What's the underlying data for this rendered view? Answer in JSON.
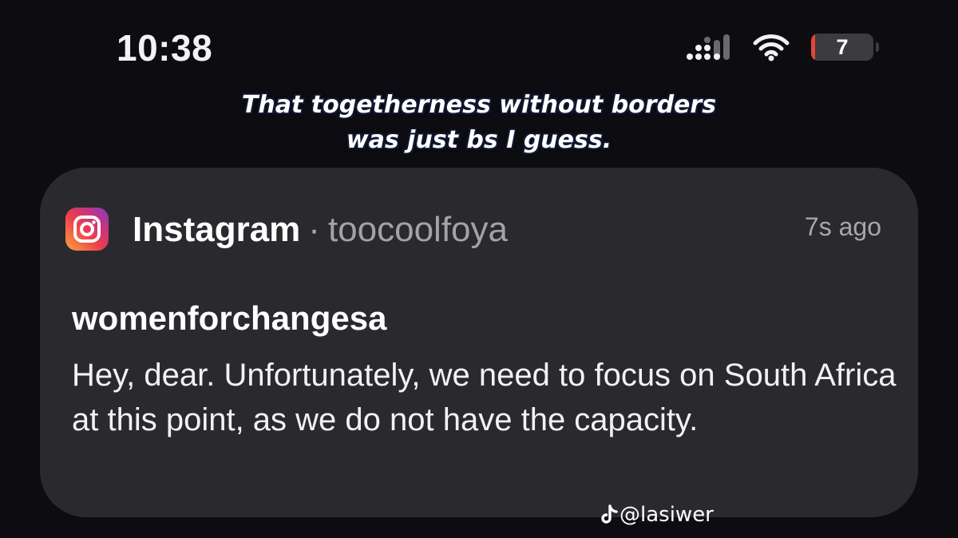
{
  "status_bar": {
    "time": "10:38",
    "battery_level": "7",
    "battery_fraction": 0.07,
    "signal_icon": "cellular-signal-icon",
    "wifi_icon": "wifi-icon",
    "battery_color": "#e5443a"
  },
  "caption": {
    "line1": "That togetherness without borders",
    "line2": "was just bs I guess."
  },
  "notification": {
    "app_icon": "instagram-icon",
    "app_name": "Instagram",
    "separator": "·",
    "account": "toocoolfoya",
    "timestamp": "7s ago",
    "title": "womenforchangesa",
    "message": "Hey, dear. Unfortunately, we need to focus on South Africa at this point, as we do not have the capacity."
  },
  "watermark": {
    "icon": "tiktok-icon",
    "handle": "@lasiwer"
  }
}
